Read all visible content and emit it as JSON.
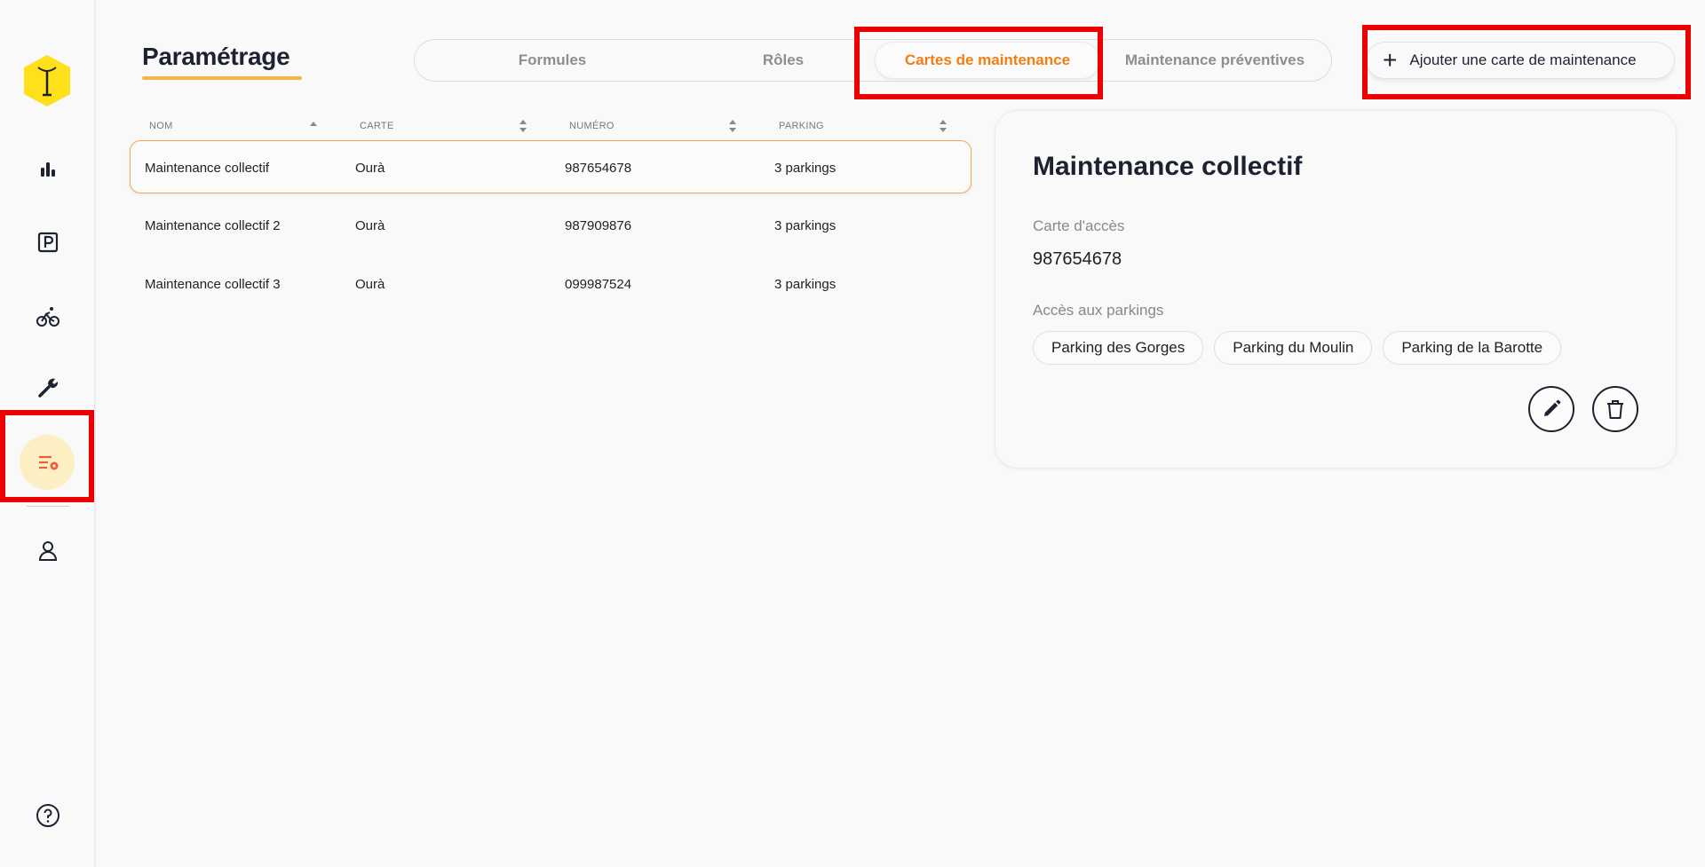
{
  "header": {
    "title": "Paramétrage",
    "accent_color": "#f5b64a"
  },
  "tabs": [
    {
      "label": "Formules",
      "active": false
    },
    {
      "label": "Rôles",
      "active": false
    },
    {
      "label": "Cartes de maintenance",
      "active": true
    },
    {
      "label": "Maintenance préventives",
      "active": false
    }
  ],
  "actions": {
    "add_label": "Ajouter une carte de maintenance",
    "add_icon": "plus-icon"
  },
  "sidebar": {
    "items": [
      {
        "name": "stats",
        "icon": "bar-chart-icon"
      },
      {
        "name": "parkings",
        "icon": "parking-icon"
      },
      {
        "name": "bikes",
        "icon": "bicycle-icon"
      },
      {
        "name": "maintenance",
        "icon": "wrench-icon"
      },
      {
        "name": "settings",
        "icon": "list-settings-icon",
        "active": true
      },
      {
        "name": "users",
        "icon": "user-icon"
      },
      {
        "name": "help",
        "icon": "help-icon"
      }
    ]
  },
  "table": {
    "columns": [
      "NOM",
      "CARTE",
      "NUMÉRO",
      "PARKING"
    ],
    "rows": [
      {
        "nom": "Maintenance collectif",
        "carte": "Ourà",
        "numero": "987654678",
        "parking": "3 parkings",
        "selected": true
      },
      {
        "nom": "Maintenance collectif 2",
        "carte": "Ourà",
        "numero": "987909876",
        "parking": "3 parkings",
        "selected": false
      },
      {
        "nom": "Maintenance collectif 3",
        "carte": "Ourà",
        "numero": "099987524",
        "parking": "3 parkings",
        "selected": false
      }
    ]
  },
  "detail": {
    "title": "Maintenance collectif",
    "card_label": "Carte d'accès",
    "card_value": "987654678",
    "parkings_label": "Accès aux parkings",
    "parkings": [
      "Parking des Gorges",
      "Parking du Moulin",
      "Parking de la Barotte"
    ],
    "edit_icon": "pencil-icon",
    "delete_icon": "trash-icon"
  },
  "colors": {
    "active_tab": "#f07f13",
    "highlight": "#ee0000",
    "logo": "#ffe01a"
  }
}
